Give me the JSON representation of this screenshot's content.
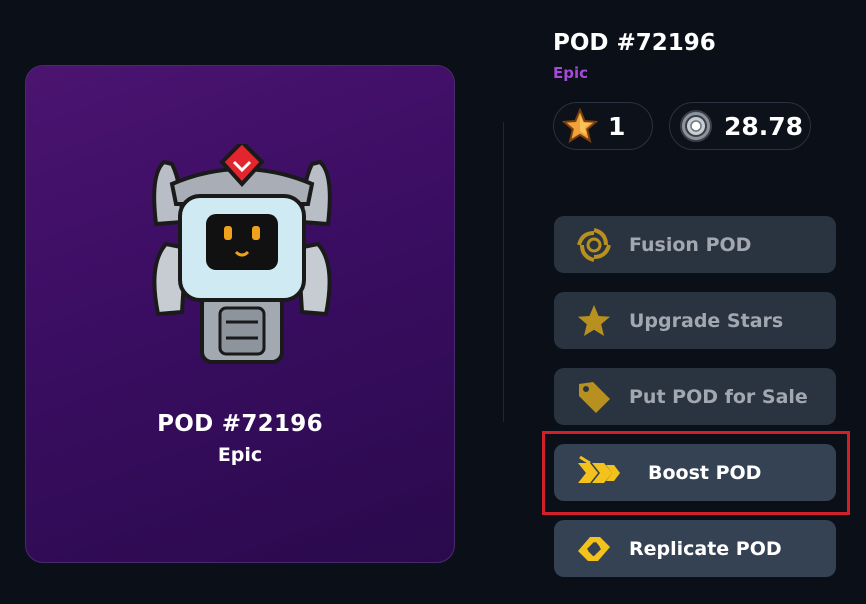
{
  "card": {
    "title": "POD #72196",
    "rarity": "Epic"
  },
  "header": {
    "title": "POD #72196",
    "rarity": "Epic",
    "rarity_color": "#a44ad6"
  },
  "stats": {
    "stars": {
      "icon": "star-icon",
      "value": "1"
    },
    "coins": {
      "icon": "coin-icon",
      "value": "28.78"
    }
  },
  "actions": [
    {
      "icon": "fusion-icon",
      "label": "Fusion POD",
      "state": "disabled"
    },
    {
      "icon": "star-icon",
      "label": "Upgrade Stars",
      "state": "disabled"
    },
    {
      "icon": "price-tag-icon",
      "label": "Put POD for Sale",
      "state": "disabled"
    },
    {
      "icon": "boost-arrows-icon",
      "label": "Boost POD",
      "state": "enabled",
      "highlighted": true
    },
    {
      "icon": "replicate-icon",
      "label": "Replicate POD",
      "state": "enabled"
    }
  ],
  "colors": {
    "background": "#0b0f17",
    "card_gradient_start": "#4b1470",
    "card_gradient_end": "#2a0a4c",
    "button_bg": "#2a3441",
    "gold": "#b8901f",
    "highlight_border": "#d0202a"
  }
}
